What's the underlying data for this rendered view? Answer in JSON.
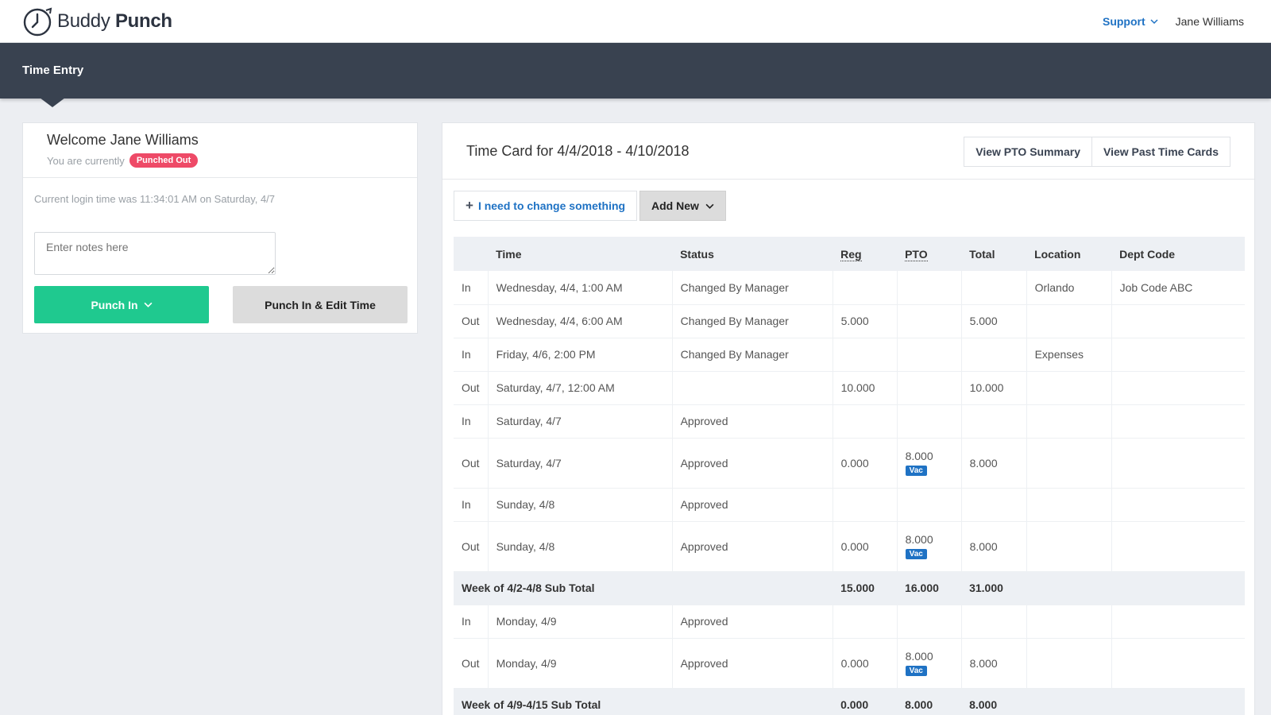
{
  "header": {
    "logo_text_1": "Buddy",
    "logo_text_2": "Punch",
    "support_label": "Support",
    "user_name": "Jane Williams"
  },
  "nav": {
    "title": "Time Entry"
  },
  "left_panel": {
    "welcome": "Welcome Jane Williams",
    "currently_label": "You are currently",
    "status_badge": "Punched Out",
    "login_time": "Current login time was 11:34:01 AM on Saturday, 4/7",
    "notes_placeholder": "Enter notes here",
    "punch_in_label": "Punch In",
    "punch_in_edit_label": "Punch In & Edit Time"
  },
  "timecard": {
    "title": "Time Card for 4/4/2018 - 4/10/2018",
    "view_pto_label": "View PTO Summary",
    "view_past_label": "View Past Time Cards",
    "change_label": "I need to change something",
    "add_new_label": "Add New",
    "columns": [
      "",
      "Time",
      "Status",
      "Reg",
      "PTO",
      "Total",
      "Location",
      "Dept Code"
    ],
    "rows": [
      {
        "type": "In",
        "time": "Wednesday, 4/4, 1:00 AM",
        "status": "Changed By Manager",
        "reg": "",
        "pto": "",
        "pto_tag": "",
        "total": "",
        "location": "Orlando",
        "dept": "Job Code ABC"
      },
      {
        "type": "Out",
        "time": "Wednesday, 4/4, 6:00 AM",
        "status": "Changed By Manager",
        "reg": "5.000",
        "pto": "",
        "pto_tag": "",
        "total": "5.000",
        "location": "",
        "dept": ""
      },
      {
        "type": "In",
        "time": "Friday, 4/6, 2:00 PM",
        "status": "Changed By Manager",
        "reg": "",
        "pto": "",
        "pto_tag": "",
        "total": "",
        "location": "Expenses",
        "dept": ""
      },
      {
        "type": "Out",
        "time": "Saturday, 4/7, 12:00 AM",
        "status": "",
        "reg": "10.000",
        "pto": "",
        "pto_tag": "",
        "total": "10.000",
        "location": "",
        "dept": ""
      },
      {
        "type": "In",
        "time": "Saturday, 4/7",
        "status": "Approved",
        "reg": "",
        "pto": "",
        "pto_tag": "",
        "total": "",
        "location": "",
        "dept": ""
      },
      {
        "type": "Out",
        "time": "Saturday, 4/7",
        "status": "Approved",
        "reg": "0.000",
        "pto": "8.000",
        "pto_tag": "Vac",
        "total": "8.000",
        "location": "",
        "dept": ""
      },
      {
        "type": "In",
        "time": "Sunday, 4/8",
        "status": "Approved",
        "reg": "",
        "pto": "",
        "pto_tag": "",
        "total": "",
        "location": "",
        "dept": ""
      },
      {
        "type": "Out",
        "time": "Sunday, 4/8",
        "status": "Approved",
        "reg": "0.000",
        "pto": "8.000",
        "pto_tag": "Vac",
        "total": "8.000",
        "location": "",
        "dept": ""
      },
      {
        "type": "subtotal",
        "label": "Week of 4/2-4/8 Sub Total",
        "reg": "15.000",
        "pto": "16.000",
        "total": "31.000"
      },
      {
        "type": "In",
        "time": "Monday, 4/9",
        "status": "Approved",
        "reg": "",
        "pto": "",
        "pto_tag": "",
        "total": "",
        "location": "",
        "dept": ""
      },
      {
        "type": "Out",
        "time": "Monday, 4/9",
        "status": "Approved",
        "reg": "0.000",
        "pto": "8.000",
        "pto_tag": "Vac",
        "total": "8.000",
        "location": "",
        "dept": ""
      },
      {
        "type": "subtotal",
        "label": "Week of 4/9-4/15 Sub Total",
        "reg": "0.000",
        "pto": "8.000",
        "total": "8.000"
      }
    ]
  },
  "colors": {
    "navbar": "#394250",
    "accent_blue": "#1f72c4",
    "punch_green": "#1fc98f",
    "badge_red": "#ee4a67"
  }
}
